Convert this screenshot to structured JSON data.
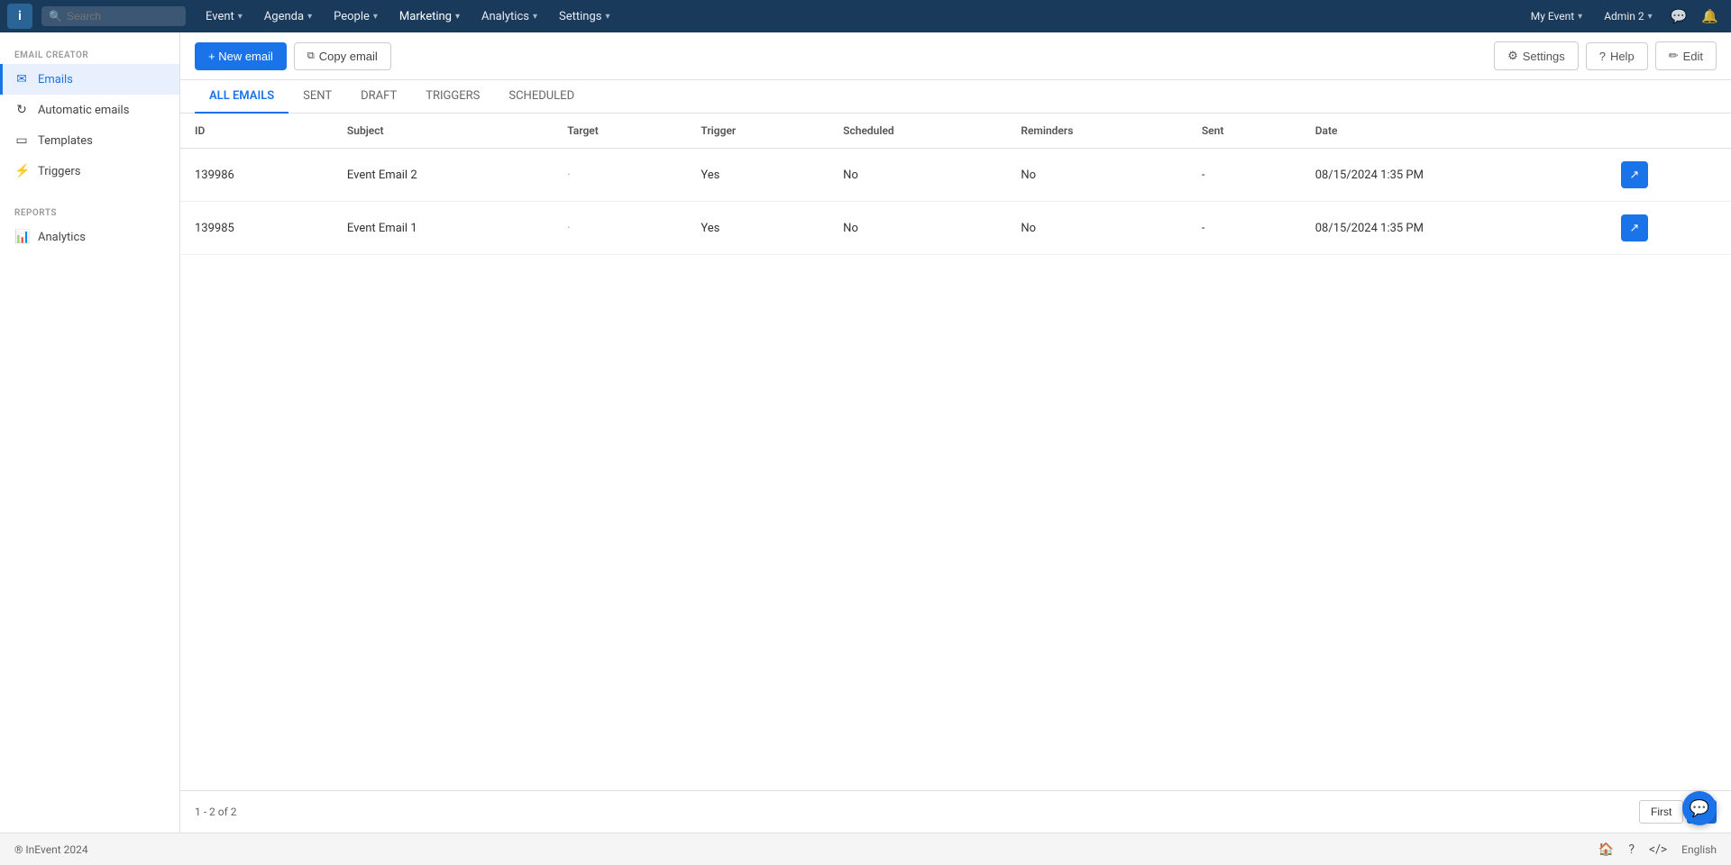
{
  "app": {
    "logo_text": "i",
    "brand_color": "#1a3a5c",
    "accent_color": "#1a73e8"
  },
  "top_nav": {
    "search_placeholder": "Search",
    "items": [
      {
        "label": "Event",
        "has_dropdown": true
      },
      {
        "label": "Agenda",
        "has_dropdown": true
      },
      {
        "label": "People",
        "has_dropdown": true
      },
      {
        "label": "Marketing",
        "has_dropdown": true,
        "active": true
      },
      {
        "label": "Analytics",
        "has_dropdown": true
      },
      {
        "label": "Settings",
        "has_dropdown": true
      }
    ],
    "my_event_label": "My Event",
    "admin_label": "Admin 2"
  },
  "sidebar": {
    "email_creator_label": "EMAIL CREATOR",
    "reports_label": "REPORTS",
    "items_email_creator": [
      {
        "id": "emails",
        "label": "Emails",
        "icon": "✉",
        "active": true
      },
      {
        "id": "automatic-emails",
        "label": "Automatic emails",
        "icon": "⟳",
        "active": false
      },
      {
        "id": "templates",
        "label": "Templates",
        "icon": "☐",
        "active": false
      },
      {
        "id": "triggers",
        "label": "Triggers",
        "icon": "⚡",
        "active": false
      }
    ],
    "items_reports": [
      {
        "id": "analytics",
        "label": "Analytics",
        "icon": "📊",
        "active": false
      }
    ]
  },
  "toolbar": {
    "new_email_label": "+ New email",
    "copy_email_label": "Copy email",
    "settings_label": "Settings",
    "help_label": "Help",
    "edit_label": "Edit"
  },
  "tabs": [
    {
      "id": "all-emails",
      "label": "ALL EMAILS",
      "active": true
    },
    {
      "id": "sent",
      "label": "SENT",
      "active": false
    },
    {
      "id": "draft",
      "label": "DRAFT",
      "active": false
    },
    {
      "id": "triggers",
      "label": "TRIGGERS",
      "active": false
    },
    {
      "id": "scheduled",
      "label": "SCHEDULED",
      "active": false
    }
  ],
  "table": {
    "columns": [
      {
        "id": "id",
        "label": "ID"
      },
      {
        "id": "subject",
        "label": "Subject"
      },
      {
        "id": "target",
        "label": "Target"
      },
      {
        "id": "trigger",
        "label": "Trigger"
      },
      {
        "id": "scheduled",
        "label": "Scheduled"
      },
      {
        "id": "reminders",
        "label": "Reminders"
      },
      {
        "id": "sent",
        "label": "Sent"
      },
      {
        "id": "date",
        "label": "Date"
      },
      {
        "id": "action",
        "label": ""
      }
    ],
    "rows": [
      {
        "id": "139986",
        "subject": "Event Email 2",
        "target": "·",
        "trigger": "Yes",
        "scheduled": "No",
        "reminders": "No",
        "sent": "-",
        "date": "08/15/2024 1:35 PM"
      },
      {
        "id": "139985",
        "subject": "Event Email 1",
        "target": "·",
        "trigger": "Yes",
        "scheduled": "No",
        "reminders": "No",
        "sent": "-",
        "date": "08/15/2024 1:35 PM"
      }
    ]
  },
  "pagination": {
    "info": "1 - 2 of 2",
    "first_label": "First",
    "page_label": "1"
  },
  "bottom_bar": {
    "copyright": "® InEvent 2024",
    "language": "English"
  }
}
